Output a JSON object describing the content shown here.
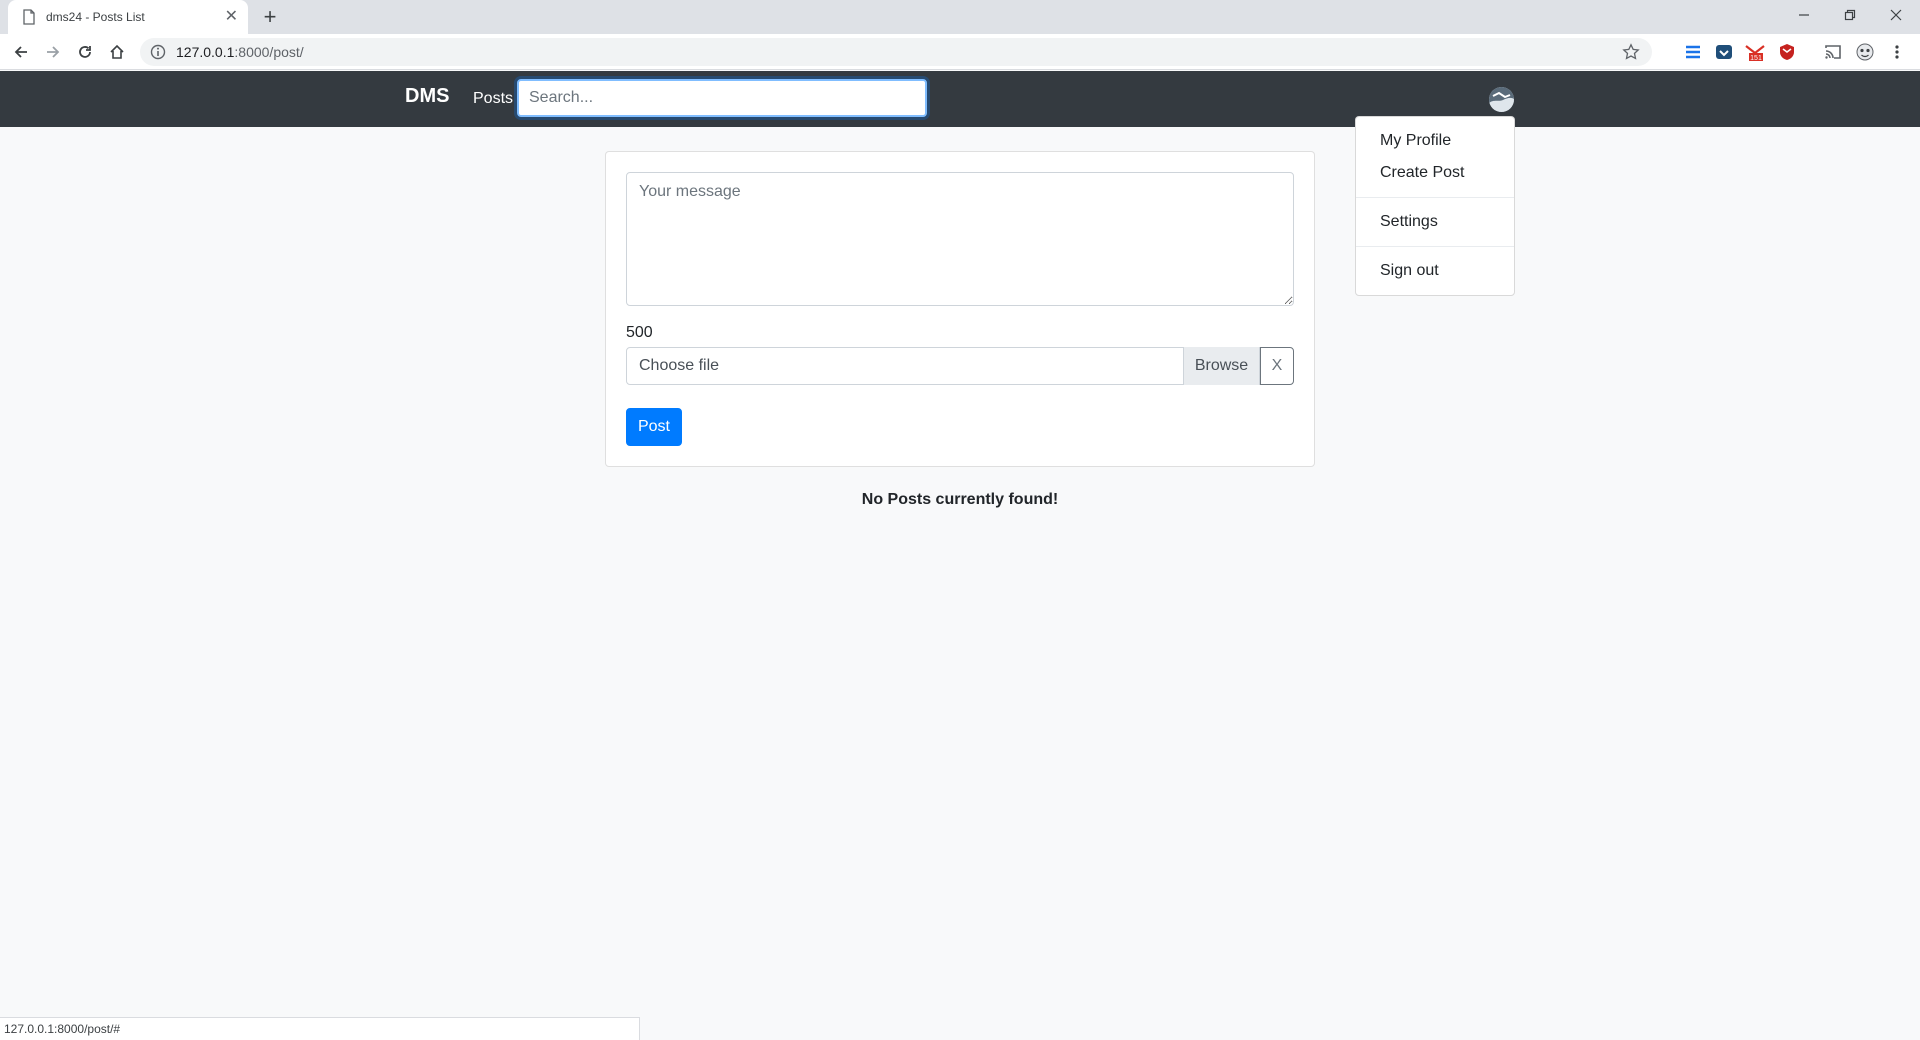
{
  "browser": {
    "tab_title": "dms24 - Posts List",
    "url_host": "127.0.0.1",
    "url_path": ":8000/post/",
    "status_url": "127.0.0.1:8000/post/#"
  },
  "navbar": {
    "brand": "DMS",
    "posts_link": "Posts",
    "search_placeholder": "Search..."
  },
  "dropdown": {
    "items": [
      "My Profile",
      "Create Post",
      "Settings",
      "Sign out"
    ]
  },
  "composer": {
    "message_placeholder": "Your message",
    "char_counter": "500",
    "file_label": "Choose file",
    "browse_label": "Browse",
    "clear_label": "X",
    "post_label": "Post"
  },
  "feed": {
    "empty_text": "No Posts currently found!"
  },
  "colors": {
    "navbar_bg": "#343a40",
    "primary": "#007bff",
    "page_bg": "#f8f9fa"
  },
  "icons": {
    "tab": "page-icon",
    "back": "arrow-left-icon",
    "forward": "arrow-right-icon",
    "reload": "reload-icon",
    "home": "home-icon",
    "info": "info-icon",
    "bookmark": "star-icon",
    "avatar": "avatar-icon"
  }
}
